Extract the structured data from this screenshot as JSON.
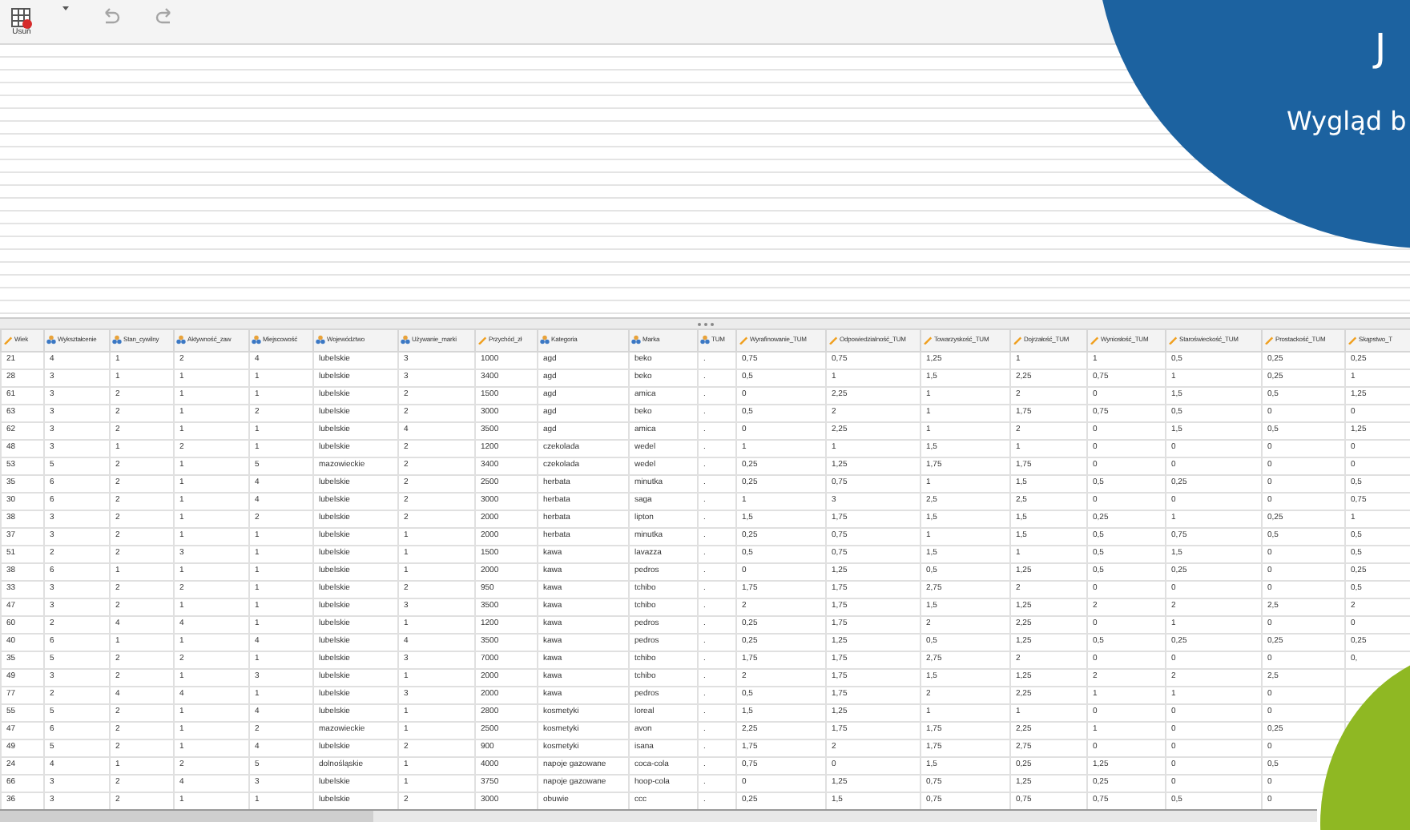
{
  "toolbar": [
    {
      "kind": "delete",
      "label": "Usuń",
      "disabled": false
    },
    {
      "kind": "undo",
      "disabled": true
    },
    {
      "kind": "redo",
      "disabled": true
    }
  ],
  "banner": {
    "title": "J",
    "subtitle": "Wygląd b"
  },
  "table": {
    "columns": [
      {
        "label": "Wiek",
        "kind": "scale"
      },
      {
        "label": "Wykształcenie",
        "kind": "nominal"
      },
      {
        "label": "Stan_cywilny",
        "kind": "nominal"
      },
      {
        "label": "Aktywność_zaw",
        "kind": "nominal"
      },
      {
        "label": "Miejscowość",
        "kind": "nominal"
      },
      {
        "label": "Województwo",
        "kind": "nominal"
      },
      {
        "label": "Używanie_marki",
        "kind": "nominal"
      },
      {
        "label": "Przychód_zł",
        "kind": "scale"
      },
      {
        "label": "Kategoria",
        "kind": "nominal"
      },
      {
        "label": "Marka",
        "kind": "nominal"
      },
      {
        "label": "TUM",
        "kind": "nominal"
      },
      {
        "label": "Wyrafinowanie_TUM",
        "kind": "scale"
      },
      {
        "label": "Odpowiedzialność_TUM",
        "kind": "scale"
      },
      {
        "label": "Towarzyskość_TUM",
        "kind": "scale"
      },
      {
        "label": "Dojrzałość_TUM",
        "kind": "scale"
      },
      {
        "label": "Wyniosłość_TUM",
        "kind": "scale"
      },
      {
        "label": "Staroświeckość_TUM",
        "kind": "scale"
      },
      {
        "label": "Prostackość_TUM",
        "kind": "scale"
      },
      {
        "label": "Skąpstwo_T",
        "kind": "scale"
      }
    ],
    "rows": [
      [
        "21",
        "4",
        "1",
        "2",
        "4",
        "lubelskie",
        "3",
        "1000",
        "agd",
        "beko",
        ".",
        "0,75",
        "0,75",
        "1,25",
        "1",
        "1",
        "0,5",
        "0,25",
        "0,25"
      ],
      [
        "28",
        "3",
        "1",
        "1",
        "1",
        "lubelskie",
        "3",
        "3400",
        "agd",
        "beko",
        ".",
        "0,5",
        "1",
        "1,5",
        "2,25",
        "0,75",
        "1",
        "0,25",
        "1"
      ],
      [
        "61",
        "3",
        "2",
        "1",
        "1",
        "lubelskie",
        "2",
        "1500",
        "agd",
        "amica",
        ".",
        "0",
        "2,25",
        "1",
        "2",
        "0",
        "1,5",
        "0,5",
        "1,25"
      ],
      [
        "63",
        "3",
        "2",
        "1",
        "2",
        "lubelskie",
        "2",
        "3000",
        "agd",
        "beko",
        ".",
        "0,5",
        "2",
        "1",
        "1,75",
        "0,75",
        "0,5",
        "0",
        "0"
      ],
      [
        "62",
        "3",
        "2",
        "1",
        "1",
        "lubelskie",
        "4",
        "3500",
        "agd",
        "amica",
        ".",
        "0",
        "2,25",
        "1",
        "2",
        "0",
        "1,5",
        "0,5",
        "1,25"
      ],
      [
        "48",
        "3",
        "1",
        "2",
        "1",
        "lubelskie",
        "2",
        "1200",
        "czekolada",
        "wedel",
        ".",
        "1",
        "1",
        "1,5",
        "1",
        "0",
        "0",
        "0",
        "0"
      ],
      [
        "53",
        "5",
        "2",
        "1",
        "5",
        "mazowieckie",
        "2",
        "3400",
        "czekolada",
        "wedel",
        ".",
        "0,25",
        "1,25",
        "1,75",
        "1,75",
        "0",
        "0",
        "0",
        "0"
      ],
      [
        "35",
        "6",
        "2",
        "1",
        "4",
        "lubelskie",
        "2",
        "2500",
        "herbata",
        "minutka",
        ".",
        "0,25",
        "0,75",
        "1",
        "1,5",
        "0,5",
        "0,25",
        "0",
        "0,5"
      ],
      [
        "30",
        "6",
        "2",
        "1",
        "4",
        "lubelskie",
        "2",
        "3000",
        "herbata",
        "saga",
        ".",
        "1",
        "3",
        "2,5",
        "2,5",
        "0",
        "0",
        "0",
        "0,75"
      ],
      [
        "38",
        "3",
        "2",
        "1",
        "2",
        "lubelskie",
        "2",
        "2000",
        "herbata",
        "lipton",
        ".",
        "1,5",
        "1,75",
        "1,5",
        "1,5",
        "0,25",
        "1",
        "0,25",
        "1"
      ],
      [
        "37",
        "3",
        "2",
        "1",
        "1",
        "lubelskie",
        "1",
        "2000",
        "herbata",
        "minutka",
        ".",
        "0,25",
        "0,75",
        "1",
        "1,5",
        "0,5",
        "0,75",
        "0,5",
        "0,5"
      ],
      [
        "51",
        "2",
        "2",
        "3",
        "1",
        "lubelskie",
        "1",
        "1500",
        "kawa",
        "lavazza",
        ".",
        "0,5",
        "0,75",
        "1,5",
        "1",
        "0,5",
        "1,5",
        "0",
        "0,5"
      ],
      [
        "38",
        "6",
        "1",
        "1",
        "1",
        "lubelskie",
        "1",
        "2000",
        "kawa",
        "pedros",
        ".",
        "0",
        "1,25",
        "0,5",
        "1,25",
        "0,5",
        "0,25",
        "0",
        "0,25"
      ],
      [
        "33",
        "3",
        "2",
        "2",
        "1",
        "lubelskie",
        "2",
        "950",
        "kawa",
        "tchibo",
        ".",
        "1,75",
        "1,75",
        "2,75",
        "2",
        "0",
        "0",
        "0",
        "0,5"
      ],
      [
        "47",
        "3",
        "2",
        "1",
        "1",
        "lubelskie",
        "3",
        "3500",
        "kawa",
        "tchibo",
        ".",
        "2",
        "1,75",
        "1,5",
        "1,25",
        "2",
        "2",
        "2,5",
        "2"
      ],
      [
        "60",
        "2",
        "4",
        "4",
        "1",
        "lubelskie",
        "1",
        "1200",
        "kawa",
        "pedros",
        ".",
        "0,25",
        "1,75",
        "2",
        "2,25",
        "0",
        "1",
        "0",
        "0"
      ],
      [
        "40",
        "6",
        "1",
        "1",
        "4",
        "lubelskie",
        "4",
        "3500",
        "kawa",
        "pedros",
        ".",
        "0,25",
        "1,25",
        "0,5",
        "1,25",
        "0,5",
        "0,25",
        "0,25",
        "0,25"
      ],
      [
        "35",
        "5",
        "2",
        "2",
        "1",
        "lubelskie",
        "3",
        "7000",
        "kawa",
        "tchibo",
        ".",
        "1,75",
        "1,75",
        "2,75",
        "2",
        "0",
        "0",
        "0",
        "0,"
      ],
      [
        "49",
        "3",
        "2",
        "1",
        "3",
        "lubelskie",
        "1",
        "2000",
        "kawa",
        "tchibo",
        ".",
        "2",
        "1,75",
        "1,5",
        "1,25",
        "2",
        "2",
        "2,5"
      ],
      [
        "77",
        "2",
        "4",
        "4",
        "1",
        "lubelskie",
        "3",
        "2000",
        "kawa",
        "pedros",
        ".",
        "0,5",
        "1,75",
        "2",
        "2,25",
        "1",
        "1",
        "0"
      ],
      [
        "55",
        "5",
        "2",
        "1",
        "4",
        "lubelskie",
        "1",
        "2800",
        "kosmetyki",
        "loreal",
        ".",
        "1,5",
        "1,25",
        "1",
        "1",
        "0",
        "0",
        "0"
      ],
      [
        "47",
        "6",
        "2",
        "1",
        "2",
        "mazowieckie",
        "1",
        "2500",
        "kosmetyki",
        "avon",
        ".",
        "2,25",
        "1,75",
        "1,75",
        "2,25",
        "1",
        "0",
        "0,25"
      ],
      [
        "49",
        "5",
        "2",
        "1",
        "4",
        "lubelskie",
        "2",
        "900",
        "kosmetyki",
        "isana",
        ".",
        "1,75",
        "2",
        "1,75",
        "2,75",
        "0",
        "0",
        "0"
      ],
      [
        "24",
        "4",
        "1",
        "2",
        "5",
        "dolnośląskie",
        "1",
        "4000",
        "napoje gazowane",
        "coca-cola",
        ".",
        "0,75",
        "0",
        "1,5",
        "0,25",
        "1,25",
        "0",
        "0,5"
      ],
      [
        "66",
        "3",
        "2",
        "4",
        "3",
        "lubelskie",
        "1",
        "3750",
        "napoje gazowane",
        "hoop-cola",
        ".",
        "0",
        "1,25",
        "0,75",
        "1,25",
        "0,25",
        "0",
        "0"
      ],
      [
        "36",
        "3",
        "2",
        "1",
        "1",
        "lubelskie",
        "2",
        "3000",
        "obuwie",
        "ccc",
        ".",
        "0,25",
        "1,5",
        "0,75",
        "0,75",
        "0,75",
        "0,5",
        "0"
      ]
    ]
  }
}
